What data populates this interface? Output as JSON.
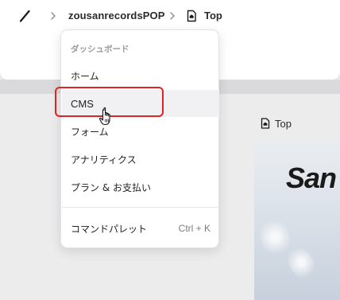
{
  "breadcrumb": {
    "site": "zousanrecordsPOP",
    "page": "Top"
  },
  "menu": {
    "header": "ダッシュボード",
    "items": [
      {
        "label": "ホーム"
      },
      {
        "label": "CMS"
      },
      {
        "label": "フォーム"
      },
      {
        "label": "アナリティクス"
      },
      {
        "label": "プラン & お支払い"
      }
    ],
    "command_palette": {
      "label": "コマンドパレット",
      "shortcut": "Ctrl + K"
    }
  },
  "preview": {
    "page_label": "Top",
    "hero_text": "San"
  },
  "colors": {
    "highlight": "#e02424",
    "hover_bg": "#f1f1f3",
    "canvas_bg": "#ececed"
  },
  "icons": {
    "slash": "slash-icon",
    "chevron": "chevron-right-icon",
    "page": "home-page-icon",
    "cursor": "hand-pointer-cursor"
  }
}
